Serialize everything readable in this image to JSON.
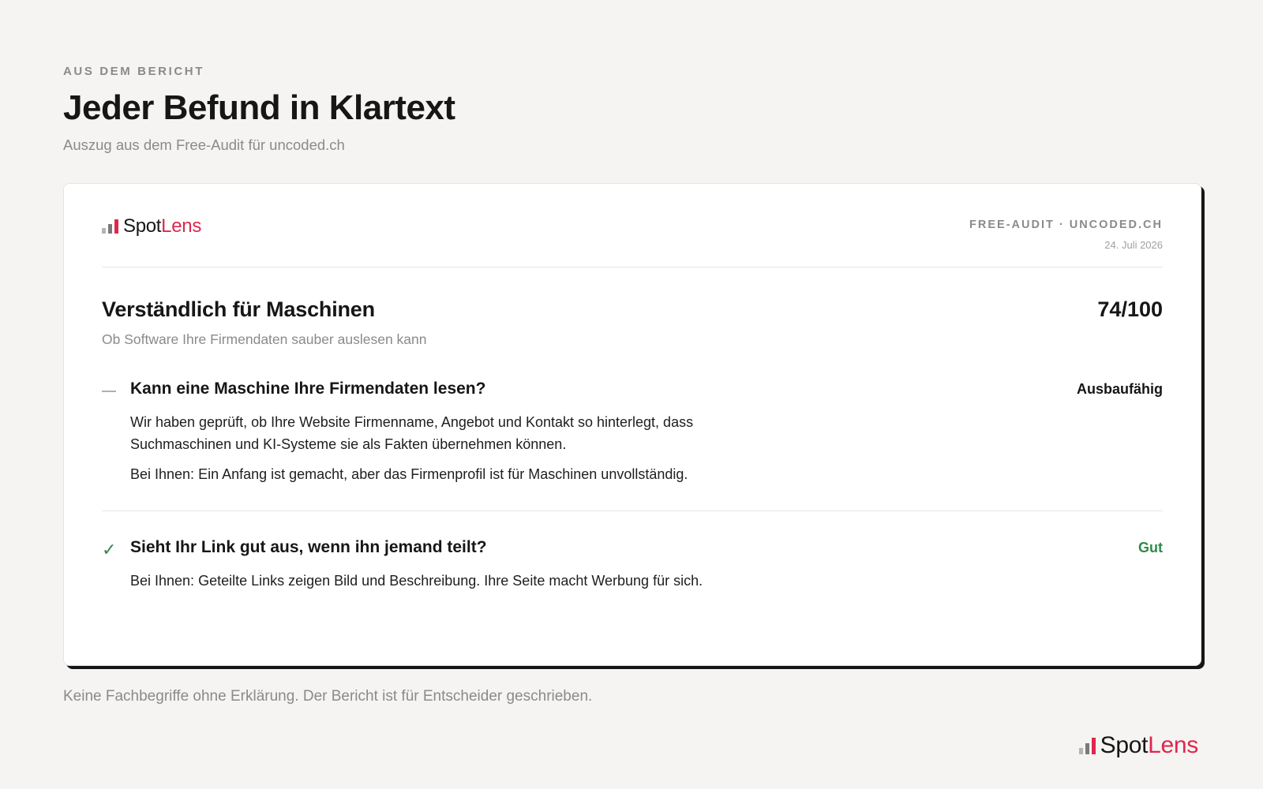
{
  "intro": {
    "eyebrow": "AUS DEM BERICHT",
    "title": "Jeder Befund in Klartext",
    "subtitle": "Auszug aus dem Free-Audit für uncoded.ch"
  },
  "brand": {
    "name_part1": "Spot",
    "name_part2": "Lens",
    "accent_color": "#e0264d"
  },
  "card": {
    "meta_title": "FREE-AUDIT · UNCODED.CH",
    "meta_date": "24. Juli 2026",
    "section": {
      "title": "Verständlich für Maschinen",
      "subtitle": "Ob Software Ihre Firmendaten sauber auslesen kann",
      "score": "74/100"
    },
    "findings": [
      {
        "icon": "dash-icon",
        "title": "Kann eine Maschine Ihre Firmendaten lesen?",
        "status": "Ausbaufähig",
        "paragraphs": [
          "Wir haben geprüft, ob Ihre Website Firmenname, Angebot und Kontakt so hinterlegt, dass Suchmaschinen und KI-Systeme sie als Fakten übernehmen können.",
          "Bei Ihnen: Ein Anfang ist gemacht, aber das Firmenprofil ist für Maschinen unvollständig."
        ]
      },
      {
        "icon": "check-icon",
        "title": "Sieht Ihr Link gut aus, wenn ihn jemand teilt?",
        "status": "Gut",
        "status_color": "#2f8a4a",
        "paragraphs": [
          "Bei Ihnen: Geteilte Links zeigen Bild und Beschreibung. Ihre Seite macht Werbung für sich."
        ]
      }
    ]
  },
  "footnote": "Keine Fachbegriffe ohne Erklärung. Der Bericht ist für Entscheider geschrieben."
}
